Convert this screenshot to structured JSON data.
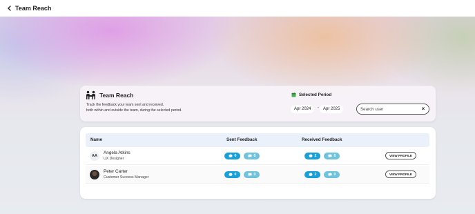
{
  "topbar": {
    "title": "Team Reach"
  },
  "header": {
    "title": "Team Reach",
    "description_line1": "Track the feedback your team sent and received,",
    "description_line2": "both within and outside the team, during the selected period.",
    "period_label": "Selected Period",
    "start_date": "Apr 2024",
    "separator": "-",
    "end_date": "Apr 2025",
    "search_placeholder": "Search user",
    "clear_label": "×"
  },
  "table": {
    "columns": {
      "name": "Name",
      "sent": "Sent Feedback",
      "received": "Received Feedback"
    },
    "rows": [
      {
        "initials": "AA",
        "name": "Angela Atkins",
        "role": "UX Designer",
        "sent_a": "0",
        "sent_b": "0",
        "received_a": "2",
        "received_b": "0",
        "action": "VIEW PROFILE"
      },
      {
        "initials": "",
        "name": "Peter Carter",
        "role": "Customer Success Manager",
        "sent_a": "0",
        "sent_b": "0",
        "received_a": "2",
        "received_b": "0",
        "action": "VIEW PROFILE"
      }
    ]
  },
  "colors": {
    "chip_dark": "#1aa0d8",
    "chip_light": "#6fc3dd",
    "table_header": "#eaf1fb"
  },
  "icons": [
    "back-arrow-icon",
    "team-icon",
    "calendar-icon",
    "close-icon",
    "comment-icon"
  ]
}
